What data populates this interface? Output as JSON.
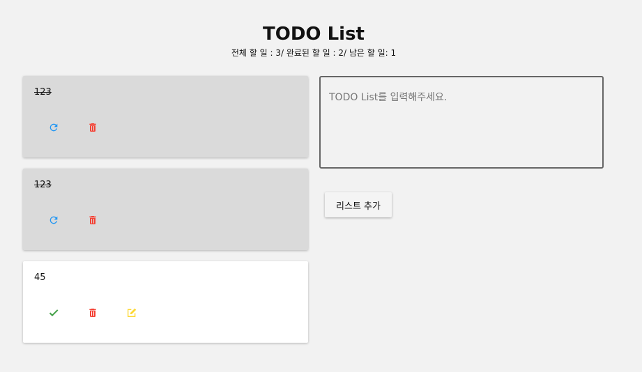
{
  "header": {
    "title": "TODO List",
    "summary": "전체 할 일 : 3/ 완료된 할 일 : 2/ 남은 할 일: 1"
  },
  "todos": [
    {
      "text": "123",
      "completed": true,
      "actions": [
        "restore-icon",
        "trash-icon"
      ]
    },
    {
      "text": "123",
      "completed": true,
      "actions": [
        "restore-icon",
        "trash-icon"
      ]
    },
    {
      "text": "45",
      "completed": false,
      "actions": [
        "check-icon",
        "trash-icon",
        "edit-icon"
      ]
    }
  ],
  "form": {
    "placeholder": "TODO List를 입력해주세요.",
    "value": "",
    "add_label": "리스트 추가"
  },
  "colors": {
    "background": "#f2f2f2",
    "done_card": "#dadada",
    "restore": "#2196f3",
    "delete": "#f44336",
    "check": "#43a047",
    "edit": "#ffeb3b"
  }
}
